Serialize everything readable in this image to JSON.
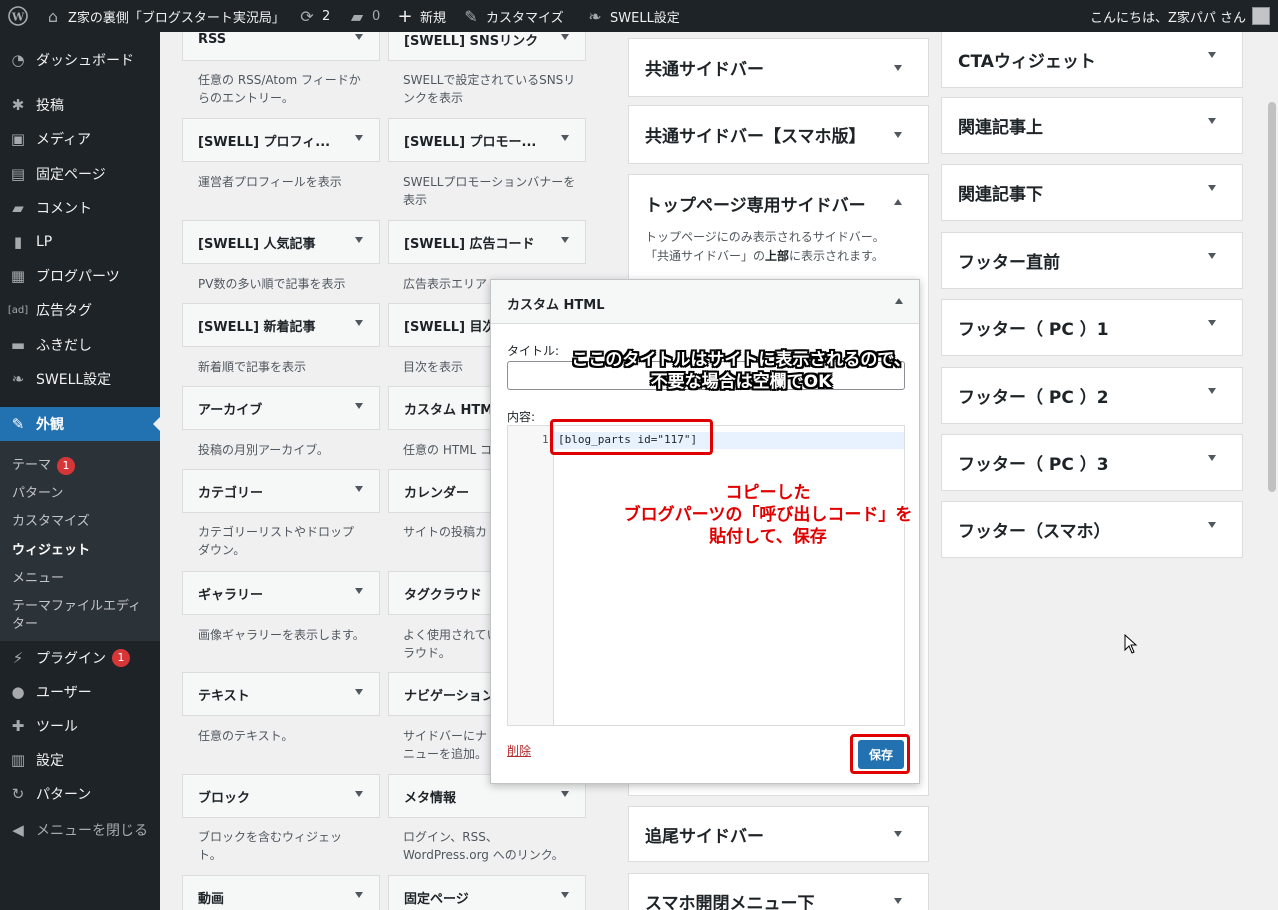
{
  "adminbar": {
    "site_name": "Z家の裏側「ブログスタート実況局」",
    "updates": "2",
    "comments": "0",
    "new_label": "新規",
    "customize_label": "カスタマイズ",
    "swell_label": "SWELL設定",
    "greeting": "こんにちは、Z家パパ さん"
  },
  "menu": {
    "items": [
      {
        "label": "ダッシュボード"
      },
      {
        "label": "投稿"
      },
      {
        "label": "メディア"
      },
      {
        "label": "固定ページ"
      },
      {
        "label": "コメント"
      },
      {
        "label": "LP"
      },
      {
        "label": "ブログパーツ"
      },
      {
        "label": "広告タグ"
      },
      {
        "label": "ふきだし"
      },
      {
        "label": "SWELL設定"
      },
      {
        "label": "外観"
      },
      {
        "label": "プラグイン",
        "badge": "1"
      },
      {
        "label": "ユーザー"
      },
      {
        "label": "ツール"
      },
      {
        "label": "設定"
      },
      {
        "label": "パターン"
      },
      {
        "label": "メニューを閉じる"
      }
    ],
    "submenu": [
      {
        "label": "テーマ",
        "badge": "1"
      },
      {
        "label": "パターン"
      },
      {
        "label": "カスタマイズ"
      },
      {
        "label": "ウィジェット"
      },
      {
        "label": "メニュー"
      },
      {
        "label": "テーマファイルエディ"
      },
      {
        "label": "ター"
      }
    ]
  },
  "widgets": {
    "col1": [
      {
        "title": "RSS",
        "desc": [
          "任意の RSS/Atom フィードか",
          "らのエントリー。"
        ]
      },
      {
        "title": "[SWELL] プロフィ...",
        "desc": [
          "運営者プロフィールを表示"
        ]
      },
      {
        "title": "[SWELL] 人気記事",
        "desc": [
          "PV数の多い順で記事を表示"
        ]
      },
      {
        "title": "[SWELL] 新着記事",
        "desc": [
          "新着順で記事を表示"
        ]
      },
      {
        "title": "アーカイブ",
        "desc": [
          "投稿の月別アーカイブ。"
        ]
      },
      {
        "title": "カテゴリー",
        "desc": [
          "カテゴリーリストやドロップ",
          "ダウン。"
        ]
      },
      {
        "title": "ギャラリー",
        "desc": [
          "画像ギャラリーを表示します。"
        ]
      },
      {
        "title": "テキスト",
        "desc": [
          "任意のテキスト。"
        ]
      },
      {
        "title": "ブロック",
        "desc": [
          "ブロックを含むウィジェッ",
          "ト。"
        ]
      },
      {
        "title": "動画",
        "desc": []
      }
    ],
    "col2": [
      {
        "title": "[SWELL] SNSリンク",
        "desc": [
          "SWELLで設定されているSNSリ",
          "ンクを表示"
        ]
      },
      {
        "title": "[SWELL] プロモー...",
        "desc": [
          "SWELLプロモーションバナーを",
          "表示"
        ]
      },
      {
        "title": "[SWELL] 広告コード",
        "desc": [
          "広告表示エリア"
        ]
      },
      {
        "title": "[SWELL] 目次",
        "desc": [
          "目次を表示"
        ]
      },
      {
        "title": "カスタム HTML",
        "desc": [
          "任意の HTML コ"
        ]
      },
      {
        "title": "カレンダー",
        "desc": [
          "サイトの投稿カ"
        ]
      },
      {
        "title": "タグクラウド",
        "desc": [
          "よく使用されてい",
          "ラウド。"
        ]
      },
      {
        "title": "ナビゲーション",
        "desc": [
          "サイドバーにナ",
          "ニューを追加。"
        ]
      },
      {
        "title": "メタ情報",
        "desc": [
          "ログイン、RSS、",
          "WordPress.org へのリンク。"
        ]
      },
      {
        "title": "固定ページ",
        "desc": []
      }
    ]
  },
  "sidebars_mid": [
    {
      "title": "共通サイドバー"
    },
    {
      "title": "共通サイドバー【スマホ版】"
    },
    {
      "title": "トップページ専用サイドバー",
      "desc1": "トップページにのみ表示されるサイドバー。",
      "desc2_pre": "「共通サイドバー」の",
      "desc2_bold": "上部",
      "desc2_post": "に表示されます。"
    },
    {
      "title": "追尾サイドバー"
    },
    {
      "title": "スマホ開閉メニュー下"
    }
  ],
  "sidebars_right": [
    {
      "title": "CTAウィジェット"
    },
    {
      "title": "関連記事上"
    },
    {
      "title": "関連記事下"
    },
    {
      "title": "フッター直前"
    },
    {
      "title": "フッター（ PC ）1"
    },
    {
      "title": "フッター（ PC ）2"
    },
    {
      "title": "フッター（ PC ）3"
    },
    {
      "title": "フッター（スマホ）"
    }
  ],
  "popup": {
    "heading": "カスタム HTML",
    "title_label": "タイトル:",
    "title_value": "",
    "content_label": "内容:",
    "line_number": "1",
    "code": "[blog_parts id=\"117\"]",
    "delete_label": "削除",
    "save_label": "保存"
  },
  "annotations": {
    "note1_line1": "ここのタイトルはサイトに表示されるので、",
    "note1_line2": "不要な場合は空欄でOK",
    "note2_line1": "コピーした",
    "note2_line2": "ブログパーツの「呼び出しコード」を",
    "note2_line3": "貼付して、保存"
  },
  "colors": {
    "accent": "#2271b1",
    "annotation_red": "#e00000",
    "badge": "#d63638"
  }
}
